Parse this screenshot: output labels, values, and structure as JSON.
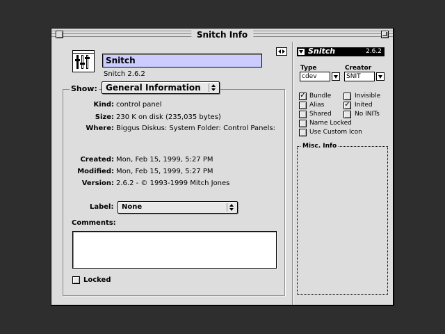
{
  "window": {
    "title": "Snitch Info"
  },
  "file": {
    "name": "Snitch",
    "version_line": "Snitch 2.6.2"
  },
  "show": {
    "label": "Show:",
    "selected": "General Information"
  },
  "info": [
    {
      "key": "Kind:",
      "value": "control panel"
    },
    {
      "key": "Size:",
      "value": "230 K on disk (235,035 bytes)"
    },
    {
      "key": "Where:",
      "value": "Biggus Diskus: System Folder: Control Panels:"
    },
    {
      "key": "Created:",
      "value": "Mon, Feb 15, 1999, 5:27 PM"
    },
    {
      "key": "Modified:",
      "value": "Mon, Feb 15, 1999, 5:27 PM"
    },
    {
      "key": "Version:",
      "value": "2.6.2 - © 1993-1999 Mitch Jones"
    }
  ],
  "label": {
    "label": "Label:",
    "selected": "None"
  },
  "comments": {
    "label": "Comments:",
    "value": ""
  },
  "locked": {
    "label": "Locked",
    "checked": false
  },
  "snitch": {
    "title": "Snitch",
    "version": "2.6.2",
    "type_label": "Type",
    "type_value": "cdev",
    "creator_label": "Creator",
    "creator_value": "SNIT",
    "flags": [
      {
        "label": "Bundle",
        "checked": true
      },
      {
        "label": "Invisible",
        "checked": false
      },
      {
        "label": "Alias",
        "checked": false
      },
      {
        "label": "Inited",
        "checked": true
      },
      {
        "label": "Shared",
        "checked": false
      },
      {
        "label": "No INITs",
        "checked": false
      },
      {
        "label": "Name Locked",
        "checked": false
      },
      {
        "label": "Use Custom Icon",
        "checked": false
      }
    ],
    "misc_label": "Misc. Info"
  },
  "colors": {
    "desktop": "#2e2e2e",
    "window": "#dddddd",
    "name_highlight": "#ccccff"
  }
}
